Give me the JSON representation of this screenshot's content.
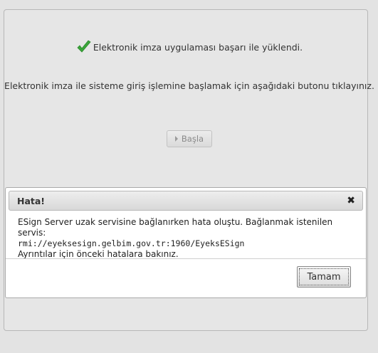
{
  "status": {
    "success_message": "Elektronik imza uygulaması başarı ile yüklendi.",
    "check_color": "#3aa53a"
  },
  "instruction": "Elektronik imza ile sisteme giriş işlemine başlamak için aşağıdaki butonu tıklayınız.",
  "start_button": {
    "label": "Başla",
    "icon": "play-triangle-icon"
  },
  "dialog": {
    "title": "Hata!",
    "close_icon": "close-x-icon",
    "message_line1": "ESign Server uzak servisine bağlanırken hata oluştu. Bağlanmak istenilen servis:",
    "message_line2": "rmi://eyeksesign.gelbim.gov.tr:1960/EyeksESign",
    "message_line3": "Ayrıntılar için önceki hatalara bakınız.",
    "ok_label": "Tamam"
  }
}
